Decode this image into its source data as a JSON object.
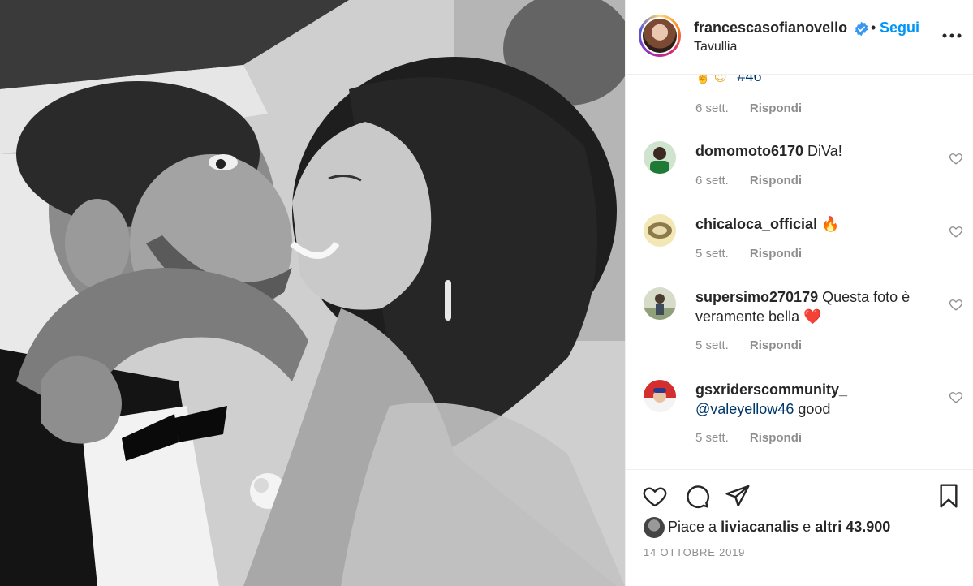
{
  "post": {
    "username": "francescasofianovello",
    "follow_label": "Segui",
    "separator": "•",
    "location": "Tavullia",
    "photo_description_icon": "bw-kiss-photo"
  },
  "comments": {
    "partial_emojis": "✌️ 😇",
    "partial_hashtag": "#46",
    "partial_time": "6 sett.",
    "reply_label": "Rispondi",
    "items": [
      {
        "username": "domomoto6170",
        "text": "DiVa!",
        "time": "6 sett."
      },
      {
        "username": "chicaloca_official",
        "text": "🔥",
        "time": "5 sett."
      },
      {
        "username": "supersimo270179",
        "text": "Questa foto è veramente bella ❤️",
        "time": "5 sett."
      },
      {
        "username": "gsxriderscommunity_",
        "mention": "@valeyellow46",
        "text": "good",
        "time": "5 sett."
      }
    ]
  },
  "footer": {
    "likes_prefix": "Piace a",
    "likes_user": "liviacanalis",
    "likes_and": "e",
    "likes_others": "altri 43.900",
    "date": "14 ottobre 2019"
  },
  "icons": {
    "verified": "verified-badge-icon",
    "more": "more-options-icon",
    "like": "heart-icon",
    "comment": "comment-bubble-icon",
    "share": "paper-plane-icon",
    "save": "bookmark-icon"
  },
  "colors": {
    "link_blue": "#0095f6",
    "mention_blue": "#00376b",
    "muted": "#8e8e8e",
    "text": "#262626"
  }
}
